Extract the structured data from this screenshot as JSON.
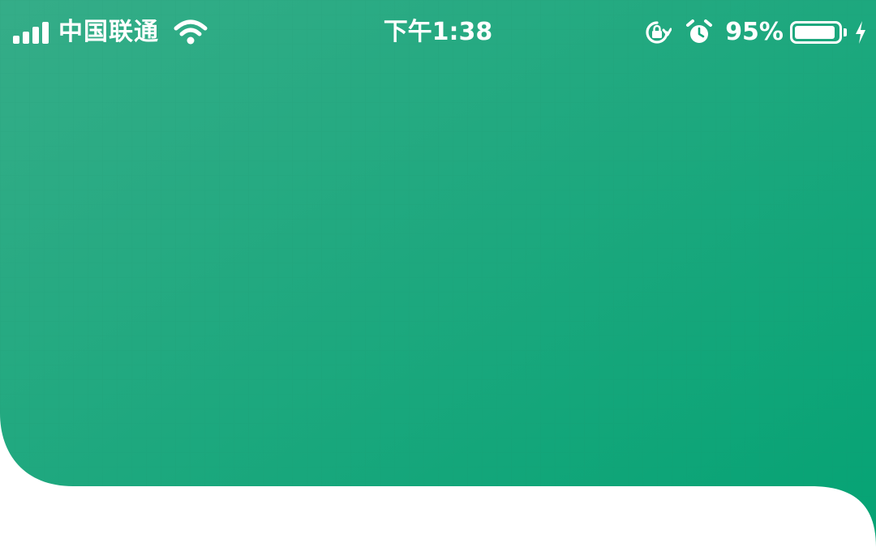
{
  "status_bar": {
    "carrier": "中国联通",
    "time": "下午1:38",
    "battery_percent": "95%",
    "battery_level": 0.95,
    "icons": [
      "signal-icon",
      "wifi-icon",
      "orientation-lock-icon",
      "alarm-icon",
      "battery-icon",
      "charging-icon"
    ]
  },
  "header": {
    "gradient_start": "#35ad88",
    "gradient_end": "#05a374",
    "grid_line_color": "#2a9a78"
  },
  "page_background": "#ffffff"
}
